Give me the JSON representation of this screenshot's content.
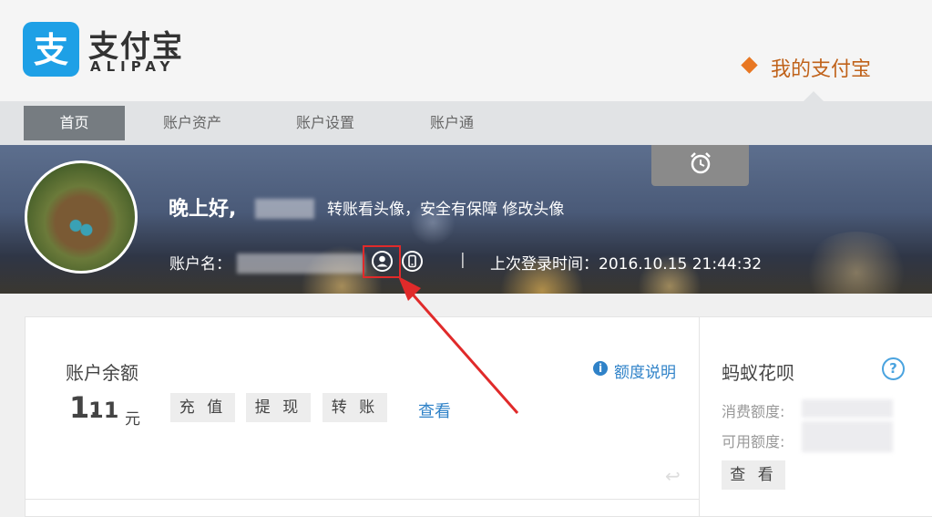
{
  "brand": {
    "logo_cn": "支付宝",
    "logo_en": "ALIPAY",
    "accent_color": "#1ea0e6",
    "logo_icon": "alipay-zhi-icon"
  },
  "header": {
    "my_alipay": "我的支付宝"
  },
  "nav": {
    "items": [
      {
        "label": "首页",
        "active": true
      },
      {
        "label": "账户资产",
        "active": false
      },
      {
        "label": "账户设置",
        "active": false
      },
      {
        "label": "账户通",
        "active": false
      }
    ]
  },
  "banner": {
    "greeting": "晚上好,",
    "avatar_hint": "转账看头像，安全有保障 修改头像",
    "account_label": "账户名：",
    "separator": "|",
    "last_login": "上次登录时间：2016.10.15 21:44:32",
    "alarm_icon": "alarm-clock-icon",
    "identity_icons": [
      "person-verified-icon",
      "phone-bound-icon"
    ],
    "highlight_color": "#e02a2a"
  },
  "balance": {
    "title": "账户余额",
    "quota_link": "额度说明",
    "amount_int": "1.",
    "amount_dec": "11",
    "unit": "元",
    "buttons": [
      "充 值",
      "提 现",
      "转 账"
    ],
    "view_link": "查看"
  },
  "huabei": {
    "title": "蚂蚁花呗",
    "spend_label": "消费额度:",
    "available_label": "可用额度:",
    "view_button": "查 看"
  }
}
